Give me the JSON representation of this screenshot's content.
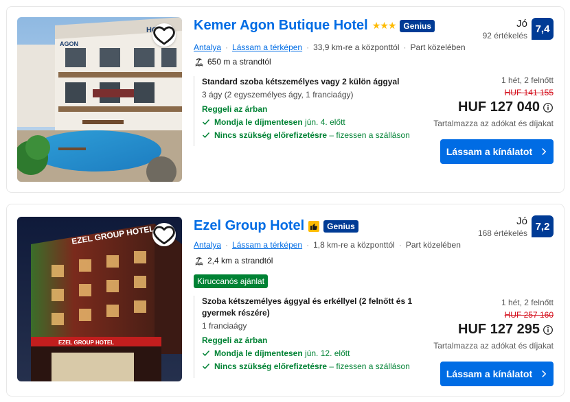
{
  "hotels": [
    {
      "name": "Kemer Agon Butique Hotel",
      "rating_badge": "stars",
      "stars": "★★★",
      "genius": "Genius",
      "city": "Antalya",
      "map_link": "Lássam a térképen",
      "distance_center": "33,9 km-re a központtól",
      "beach_note": "Part közelében",
      "beach_distance": "650 m a strandtól",
      "deal_badge": "",
      "room_title": "Standard szoba kétszemélyes vagy 2 külön ággyal",
      "room_beds": "3 ágy (2 egyszemélyes ágy, 1 franciaágy)",
      "breakfast": "Reggeli az árban",
      "perk1_bold": "Mondja le díjmentesen",
      "perk1_rest": "jún. 4. előtt",
      "perk2_bold": "Nincs szükség előrefizetésre",
      "perk2_rest": "– fizessen a szálláson",
      "review_word": "Jó",
      "review_count": "92 értékelés",
      "score": "7,4",
      "stay": "1 hét, 2 felnőtt",
      "old_price": "HUF 141 155",
      "price": "HUF 127 040",
      "taxes": "Tartalmazza az adókat és díjakat",
      "cta": "Lássam a kínálatot",
      "photo_sign": "HOTEL",
      "photo_sign2": "AGON"
    },
    {
      "name": "Ezel Group Hotel",
      "rating_badge": "thumb",
      "stars": "",
      "genius": "Genius",
      "city": "Antalya",
      "map_link": "Lássam a térképen",
      "distance_center": "1,8 km-re a központtól",
      "beach_note": "Part közelében",
      "beach_distance": "2,4 km a strandtól",
      "deal_badge": "Kiruccanós ajánlat",
      "room_title": "Szoba kétszemélyes ággyal és erkéllyel (2 felnőtt és 1 gyermek részére)",
      "room_beds": "1 franciaágy",
      "breakfast": "Reggeli az árban",
      "perk1_bold": "Mondja le díjmentesen",
      "perk1_rest": "jún. 12. előtt",
      "perk2_bold": "Nincs szükség előrefizetésre",
      "perk2_rest": "– fizessen a szálláson",
      "review_word": "Jó",
      "review_count": "168 értékelés",
      "score": "7,2",
      "stay": "1 hét, 2 felnőtt",
      "old_price": "HUF 257 160",
      "price": "HUF 127 295",
      "taxes": "Tartalmazza az adókat és díjakat",
      "cta": "Lássam a kínálatot",
      "photo_sign": "EZEL GROUP HOTEL",
      "photo_sign2": "EZEL GROUP HOTEL"
    }
  ],
  "colors": {
    "link": "#006ce4",
    "genius": "#003b95",
    "score": "#003b95",
    "green": "#008234",
    "strike": "#d4111e",
    "star": "#febb02"
  },
  "icons": [
    "heart-icon",
    "beach-icon",
    "check-icon",
    "chevron-right-icon",
    "info-icon",
    "thumbs-up-icon"
  ]
}
